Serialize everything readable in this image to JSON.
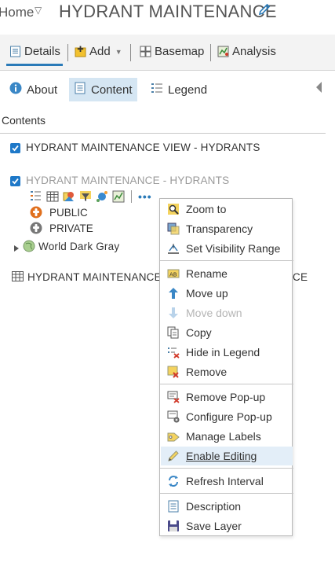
{
  "header": {
    "home_label": "Home",
    "home_caret": "▽",
    "title": "HYDRANT MAINTENANCE",
    "edit_icon": "pencil-icon"
  },
  "toolbar": {
    "details_label": "Details",
    "add_label": "Add",
    "basemap_label": "Basemap",
    "analysis_label": "Analysis"
  },
  "tabs": {
    "about_label": "About",
    "content_label": "Content",
    "legend_label": "Legend"
  },
  "contents": {
    "heading": "Contents",
    "layers": [
      {
        "title": "HYDRANT MAINTENANCE VIEW - HYDRANTS",
        "checked": true
      },
      {
        "title": "HYDRANT MAINTENANCE - HYDRANTS",
        "checked": true
      }
    ],
    "legend_items": [
      "PUBLIC",
      "PRIVATE"
    ],
    "basemap": "World Dark Gray",
    "table_layer_start": "HYDRANT MAINTENANCE",
    "table_layer_end": "CE"
  },
  "menu": {
    "groups": [
      [
        "Zoom to",
        "Transparency",
        "Set Visibility Range"
      ],
      [
        "Rename",
        "Move up",
        "Move down",
        "Copy",
        "Hide in Legend",
        "Remove"
      ],
      [
        "Remove Pop-up",
        "Configure Pop-up",
        "Manage Labels",
        "Enable Editing"
      ],
      [
        "Refresh Interval"
      ],
      [
        "Description",
        "Save Layer"
      ]
    ],
    "disabled_item": "Move down",
    "hovered_item": "Enable Editing"
  },
  "colors": {
    "accent": "#2a7ab8",
    "checkbox": "#1e78c8",
    "active_tab_bg": "#d5e6f3",
    "public_symbol": "#e0701e",
    "private_symbol": "#777777"
  }
}
